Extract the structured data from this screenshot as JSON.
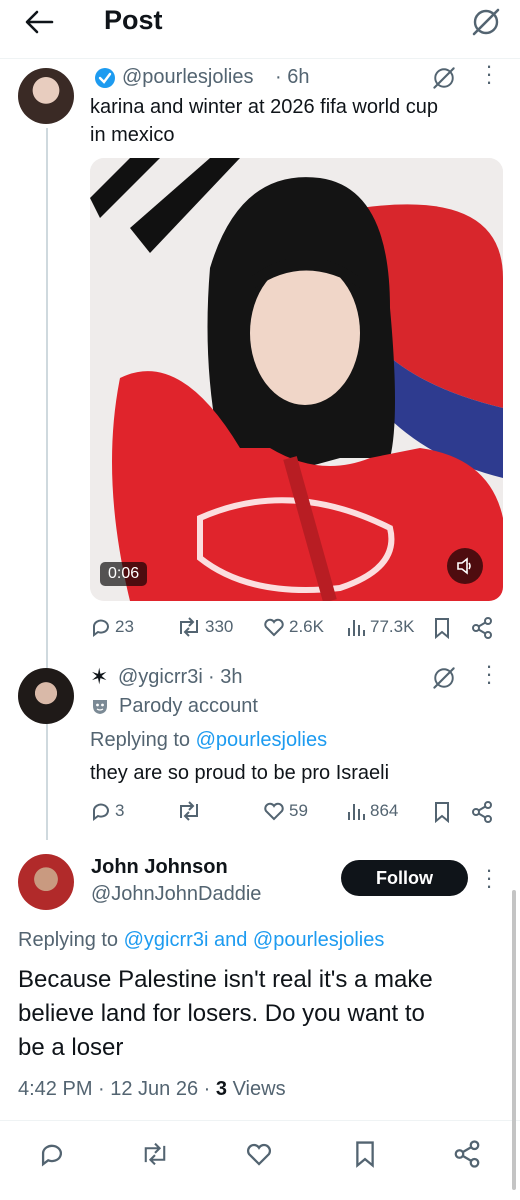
{
  "header": {
    "title": "Post",
    "back_icon": "arrow-left-icon",
    "grok_icon": "grok-icon"
  },
  "quoted_post": {
    "handle": "@pourlesjolies",
    "time": "· 6h",
    "text_line1": "karina and winter at 2026 fifa world cup",
    "text_line2": "in mexico",
    "video_duration": "0:06",
    "metrics": {
      "replies": "23",
      "reposts": "330",
      "likes": "2.6K",
      "views": "77.3K"
    }
  },
  "reply_post": {
    "name_prefix": "✶",
    "handle": "@ygicrr3i",
    "time": "· 3h",
    "badge": "Parody account",
    "replying_prefix": "Replying to",
    "replying_to": "@pourlesjolies",
    "text": "they are so proud to be pro Israeli",
    "metrics": {
      "replies": "3",
      "reposts": "",
      "likes": "59",
      "views": "864"
    }
  },
  "main_post": {
    "name": "John Johnson",
    "handle": "@JohnJohnDaddie",
    "follow_label": "Follow",
    "replying_prefix": "Replying to",
    "replying_to_1": "@ygicrr3i",
    "replying_and": "and",
    "replying_to_2": "@pourlesjolies",
    "text_line1": "Because Palestine isn't real it's a make",
    "text_line2": "believe land for losers. Do you want to",
    "text_line3": "be a loser",
    "time": "4:42 PM · 12 Jun 26 ·",
    "views_count": "3",
    "views_label": "Views"
  },
  "colors": {
    "accent": "#1d9bf0",
    "text": "#0f1419",
    "muted": "#536471",
    "verified": "#1d9bf0"
  }
}
